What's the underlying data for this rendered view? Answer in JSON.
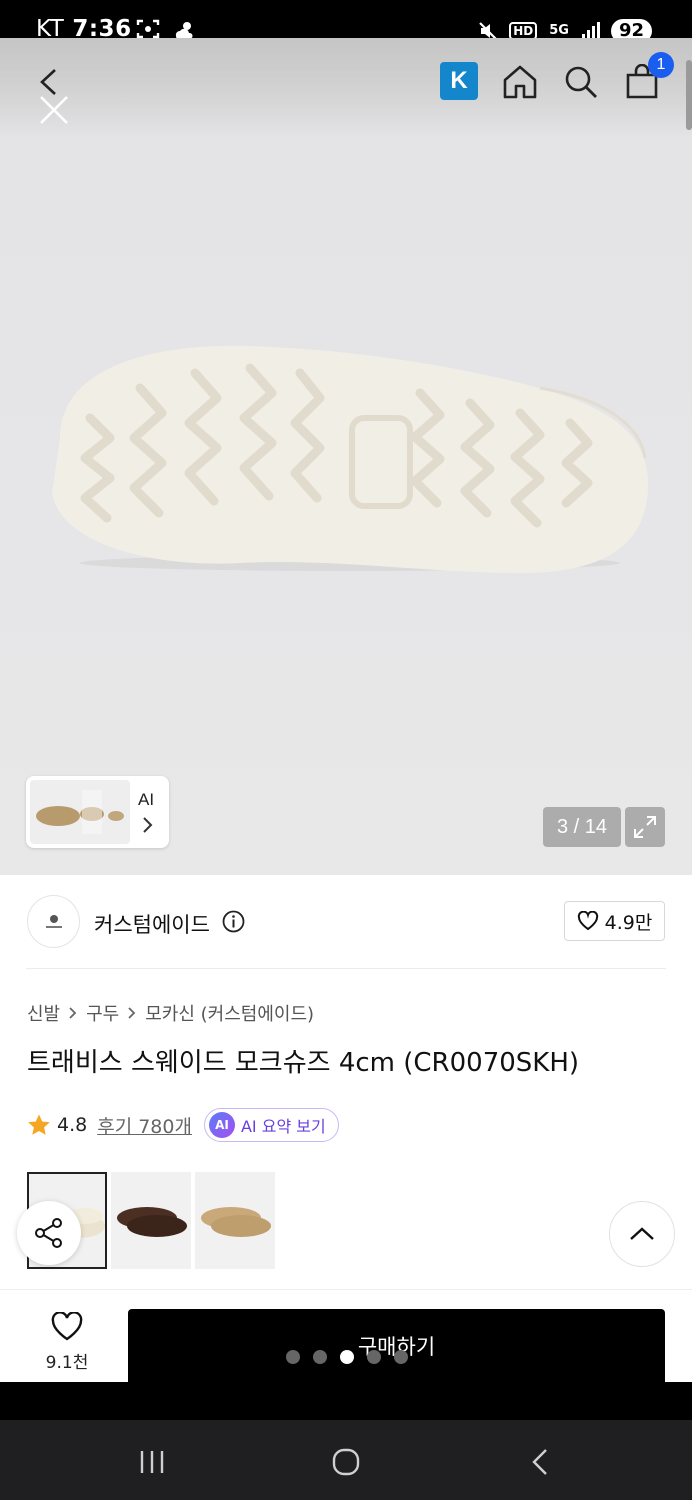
{
  "status_bar": {
    "carrier": "KT",
    "time": "7:36",
    "network": "5G",
    "hd": "HD",
    "battery": "92"
  },
  "header": {
    "k_badge": "K",
    "cart_count": "1"
  },
  "gallery": {
    "counter": "3 / 14",
    "ai_label": "AI"
  },
  "brand": {
    "name": "커스텀에이드",
    "likes": "4.9만"
  },
  "breadcrumb": [
    "신발",
    "구두",
    "모카신 (커스텀에이드)"
  ],
  "product": {
    "title": "트래비스 스웨이드 모크슈즈 4cm (CR0070SKH)",
    "rating": "4.8",
    "reviews": "후기 780개",
    "ai_summary": "AI 요약 보기",
    "ai_badge": "AI"
  },
  "variants": [
    {
      "color": "#ebe3cf",
      "name": "cream"
    },
    {
      "color": "#4a2f22",
      "name": "brown"
    },
    {
      "color": "#c9a97a",
      "name": "sand"
    }
  ],
  "bottom_bar": {
    "wish_count": "9.1천",
    "buy_label": "구매하기"
  },
  "colors": {
    "accent_blue": "#1a5ef0",
    "k_badge_blue": "#1487cc",
    "star": "#f5a623",
    "ai_purple": "#6a3fe0"
  },
  "page_dots": {
    "count": 5,
    "active": 3
  }
}
